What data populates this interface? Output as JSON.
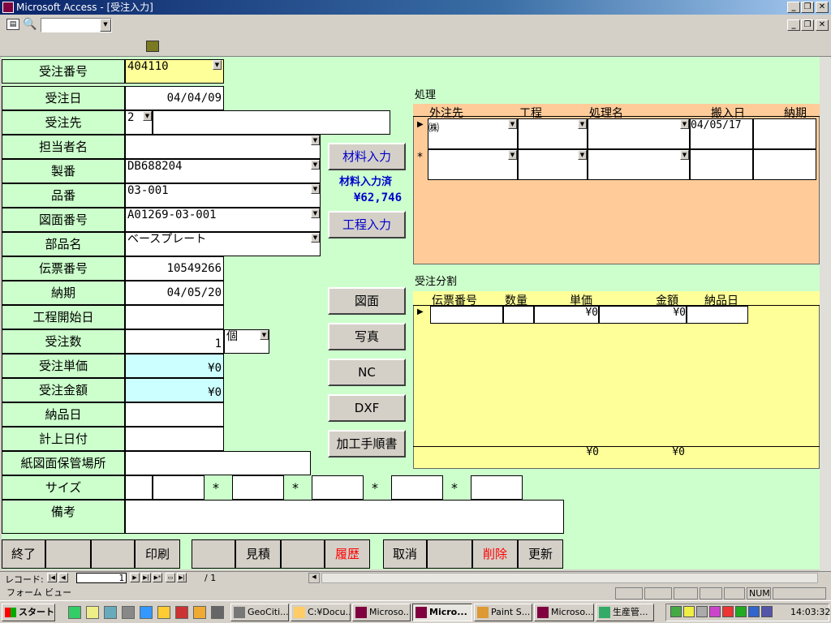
{
  "window": {
    "app_title": "Microsoft Access - [受注入力]"
  },
  "fields": {
    "order_no": {
      "label": "受注番号",
      "value": "404110"
    },
    "order_date": {
      "label": "受注日",
      "value": "04/04/09"
    },
    "customer": {
      "label": "受注先",
      "code": "2",
      "value": ""
    },
    "person": {
      "label": "担当者名",
      "value": ""
    },
    "serial": {
      "label": "製番",
      "value": "DB688204"
    },
    "part_no": {
      "label": "品番",
      "value": "03-001"
    },
    "drawing_no": {
      "label": "図面番号",
      "value": "A01269-03-001"
    },
    "part_name": {
      "label": "部品名",
      "value": "ベースプレート"
    },
    "slip_no": {
      "label": "伝票番号",
      "value": "10549266"
    },
    "delivery": {
      "label": "納期",
      "value": "04/05/20"
    },
    "process_start": {
      "label": "工程開始日",
      "value": ""
    },
    "quantity": {
      "label": "受注数",
      "value": "1",
      "unit": "個"
    },
    "unit_price": {
      "label": "受注単価",
      "value": "¥0"
    },
    "amount": {
      "label": "受注金額",
      "value": "¥0"
    },
    "delivered": {
      "label": "納品日",
      "value": ""
    },
    "booking": {
      "label": "計上日付",
      "value": ""
    },
    "storage": {
      "label": "紙図面保管場所",
      "value": ""
    },
    "size": {
      "label": "サイズ",
      "sep": "*"
    },
    "remarks": {
      "label": "備考",
      "value": ""
    }
  },
  "mid": {
    "material_btn": "材料入力",
    "material_done": "材料入力済",
    "material_amount": "¥62,746",
    "process_btn": "工程入力",
    "drawing_btn": "図面",
    "photo_btn": "写真",
    "nc_btn": "NC",
    "dxf_btn": "DXF",
    "procedure_btn": "加工手順書"
  },
  "process": {
    "title": "処理",
    "columns": [
      "外注先",
      "工程",
      "処理名",
      "搬入日",
      "納期"
    ],
    "row1": {
      "vendor": "㈱",
      "date_in": "04/05/17"
    },
    "new_row_marker": "*"
  },
  "split": {
    "title": "受注分割",
    "columns": [
      "伝票番号",
      "数量",
      "単価",
      "金額",
      "納品日"
    ],
    "row1": {
      "unit_price": "¥0",
      "amount": "¥0"
    },
    "totals": {
      "unit_price": "¥0",
      "amount": "¥0"
    }
  },
  "footer": {
    "exit": "終了",
    "print": "印刷",
    "estimate": "見積",
    "history": "履歴",
    "cancel": "取消",
    "delete": "削除",
    "update": "更新"
  },
  "nav": {
    "label": "レコード:",
    "current": "1",
    "total": "/ 1"
  },
  "status": {
    "text": "フォーム ビュー",
    "num": "NUM"
  },
  "taskbar": {
    "start": "スタート",
    "tasks": [
      "GeoCiti...",
      "C:¥Docu...",
      "Microso...",
      "Micro...",
      "Paint S...",
      "Microso...",
      "生産管..."
    ],
    "clock": "14:03:32"
  },
  "colors": {
    "form_bg": "#ccffcc",
    "grid_header": "#ffcc99",
    "yellow": "#ffff99",
    "cyan": "#ccffff",
    "link_blue": "#0000cc",
    "red": "#ff0000"
  }
}
